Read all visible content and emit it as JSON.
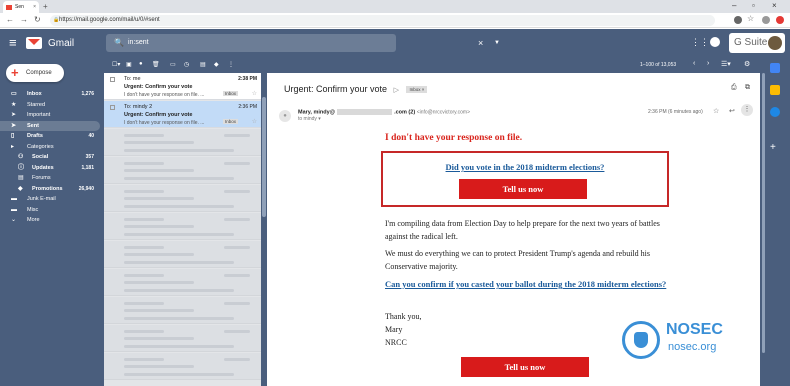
{
  "browser": {
    "tab_title": "Sen",
    "url": "https://mail.google.com/mail/u/0/#sent"
  },
  "header": {
    "app_name": "Gmail",
    "search_value": "in:sent",
    "gsuite_label": "G Suite"
  },
  "sidebar": {
    "compose_label": "Compose",
    "items": [
      {
        "icon": "inbox-icon",
        "label": "Inbox",
        "count": "1,276",
        "bold": true
      },
      {
        "icon": "star-icon",
        "label": "Starred",
        "count": ""
      },
      {
        "icon": "important-icon",
        "label": "Important",
        "count": ""
      },
      {
        "icon": "send-icon",
        "label": "Sent",
        "count": "",
        "selected": true,
        "bold": true
      },
      {
        "icon": "draft-icon",
        "label": "Drafts",
        "count": "40",
        "bold": true
      },
      {
        "icon": "label-icon",
        "label": "Categories",
        "count": ""
      },
      {
        "icon": "social-icon",
        "label": "Social",
        "count": "357",
        "sub": true,
        "bold": true
      },
      {
        "icon": "info-icon",
        "label": "Updates",
        "count": "1,181",
        "sub": true,
        "bold": true
      },
      {
        "icon": "forum-icon",
        "label": "Forums",
        "count": "",
        "sub": true
      },
      {
        "icon": "tag-icon",
        "label": "Promotions",
        "count": "26,940",
        "sub": true,
        "bold": true
      },
      {
        "icon": "folder-icon",
        "label": "Junk E-mail",
        "count": ""
      },
      {
        "icon": "folder-icon",
        "label": "Misc",
        "count": ""
      },
      {
        "icon": "chevron-down-icon",
        "label": "More",
        "count": ""
      }
    ]
  },
  "list": {
    "rows": [
      {
        "from": "To: me",
        "time": "2:38 PM",
        "subject": "Urgent: Confirm your vote",
        "snippet": "I don't have your response on file. ...",
        "badge": "Inbox"
      },
      {
        "from": "To: mindy 2",
        "time": "2:36 PM",
        "subject": "Urgent: Confirm your vote",
        "snippet": "I don't have your response on file. ...",
        "badge": "Inbox"
      }
    ]
  },
  "reader": {
    "pagination": "1–100 of 13,053",
    "subject": "Urgent: Confirm your vote",
    "label": "Inbox ×",
    "sender_name": "Mary, mindy@",
    "sender_suffix": ".com (2)",
    "sender_email": "<info@nrccvictory.com>",
    "to_line": "to mindy ▾",
    "time": "2:36 PM (6 minutes ago)",
    "headline": "I don't have your response on file.",
    "question": "Did you vote in the 2018 midterm elections?",
    "cta": "Tell us now",
    "para1": "I'm compiling data from Election Day to help prepare for the next two years of battles against the radical left.",
    "para2": "We must do everything we can to protect President Trump's agenda and rebuild his Conservative majority.",
    "link2": "Can you confirm if you casted your ballot during the 2018 midterm elections?",
    "sign1": "Thank you,",
    "sign2": "Mary",
    "sign3": "NRCC",
    "cta2": "Tell us now"
  },
  "watermark": {
    "line1": "NOSEC",
    "line2": "nosec.org"
  },
  "colors": {
    "header": "#4a5e7d",
    "accent_red": "#d81b1b",
    "link_blue": "#1a5a9a"
  }
}
